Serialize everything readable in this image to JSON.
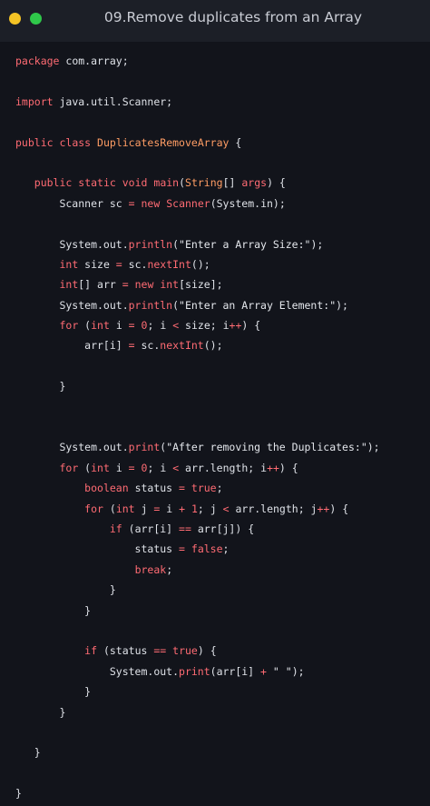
{
  "window": {
    "title": "09.Remove duplicates from an Array",
    "colors": {
      "close": "#f4c325",
      "maximize": "#2fc84a",
      "background": "#12141b",
      "titlebar": "#1c1f27",
      "keyword": "#ff6b73",
      "class_name": "#ff9d64",
      "text": "#dfe2e8"
    }
  },
  "code": {
    "language": "java",
    "lines": [
      [
        {
          "t": "kw",
          "v": "package"
        },
        {
          "t": "plain",
          "v": " com.array;"
        }
      ],
      [],
      [
        {
          "t": "kw",
          "v": "import"
        },
        {
          "t": "plain",
          "v": " java.util.Scanner;"
        }
      ],
      [],
      [
        {
          "t": "kw",
          "v": "public"
        },
        {
          "t": "plain",
          "v": " "
        },
        {
          "t": "kw",
          "v": "class"
        },
        {
          "t": "plain",
          "v": " "
        },
        {
          "t": "cls",
          "v": "DuplicatesRemoveArray"
        },
        {
          "t": "plain",
          "v": " {"
        }
      ],
      [],
      [
        {
          "t": "plain",
          "v": "   "
        },
        {
          "t": "kw",
          "v": "public"
        },
        {
          "t": "plain",
          "v": " "
        },
        {
          "t": "kw",
          "v": "static"
        },
        {
          "t": "plain",
          "v": " "
        },
        {
          "t": "kw",
          "v": "void"
        },
        {
          "t": "plain",
          "v": " "
        },
        {
          "t": "fn",
          "v": "main"
        },
        {
          "t": "plain",
          "v": "("
        },
        {
          "t": "cls",
          "v": "String"
        },
        {
          "t": "plain",
          "v": "[] "
        },
        {
          "t": "kw",
          "v": "args"
        },
        {
          "t": "plain",
          "v": ") {"
        }
      ],
      [
        {
          "t": "plain",
          "v": "       Scanner sc "
        },
        {
          "t": "op",
          "v": "="
        },
        {
          "t": "plain",
          "v": " "
        },
        {
          "t": "kw",
          "v": "new"
        },
        {
          "t": "plain",
          "v": " "
        },
        {
          "t": "fn",
          "v": "Scanner"
        },
        {
          "t": "plain",
          "v": "(System.in);"
        }
      ],
      [],
      [
        {
          "t": "plain",
          "v": "       System.out."
        },
        {
          "t": "fn",
          "v": "println"
        },
        {
          "t": "plain",
          "v": "("
        },
        {
          "t": "str",
          "v": "\"Enter a Array Size:\""
        },
        {
          "t": "plain",
          "v": ");"
        }
      ],
      [
        {
          "t": "plain",
          "v": "       "
        },
        {
          "t": "kw",
          "v": "int"
        },
        {
          "t": "plain",
          "v": " size "
        },
        {
          "t": "op",
          "v": "="
        },
        {
          "t": "plain",
          "v": " sc."
        },
        {
          "t": "fn",
          "v": "nextInt"
        },
        {
          "t": "plain",
          "v": "();"
        }
      ],
      [
        {
          "t": "plain",
          "v": "       "
        },
        {
          "t": "kw",
          "v": "int"
        },
        {
          "t": "plain",
          "v": "[] arr "
        },
        {
          "t": "op",
          "v": "="
        },
        {
          "t": "plain",
          "v": " "
        },
        {
          "t": "kw",
          "v": "new"
        },
        {
          "t": "plain",
          "v": " "
        },
        {
          "t": "kw",
          "v": "int"
        },
        {
          "t": "plain",
          "v": "[size];"
        }
      ],
      [
        {
          "t": "plain",
          "v": "       System.out."
        },
        {
          "t": "fn",
          "v": "println"
        },
        {
          "t": "plain",
          "v": "("
        },
        {
          "t": "str",
          "v": "\"Enter an Array Element:\""
        },
        {
          "t": "plain",
          "v": ");"
        }
      ],
      [
        {
          "t": "plain",
          "v": "       "
        },
        {
          "t": "kw",
          "v": "for"
        },
        {
          "t": "plain",
          "v": " ("
        },
        {
          "t": "kw",
          "v": "int"
        },
        {
          "t": "plain",
          "v": " i "
        },
        {
          "t": "op",
          "v": "="
        },
        {
          "t": "plain",
          "v": " "
        },
        {
          "t": "num",
          "v": "0"
        },
        {
          "t": "plain",
          "v": "; i "
        },
        {
          "t": "op",
          "v": "<"
        },
        {
          "t": "plain",
          "v": " size; i"
        },
        {
          "t": "op",
          "v": "++"
        },
        {
          "t": "plain",
          "v": ") {"
        }
      ],
      [
        {
          "t": "plain",
          "v": "           arr[i] "
        },
        {
          "t": "op",
          "v": "="
        },
        {
          "t": "plain",
          "v": " sc."
        },
        {
          "t": "fn",
          "v": "nextInt"
        },
        {
          "t": "plain",
          "v": "();"
        }
      ],
      [],
      [
        {
          "t": "plain",
          "v": "       }"
        }
      ],
      [],
      [],
      [
        {
          "t": "plain",
          "v": "       System.out."
        },
        {
          "t": "fn",
          "v": "print"
        },
        {
          "t": "plain",
          "v": "("
        },
        {
          "t": "str",
          "v": "\"After removing the Duplicates:\""
        },
        {
          "t": "plain",
          "v": ");"
        }
      ],
      [
        {
          "t": "plain",
          "v": "       "
        },
        {
          "t": "kw",
          "v": "for"
        },
        {
          "t": "plain",
          "v": " ("
        },
        {
          "t": "kw",
          "v": "int"
        },
        {
          "t": "plain",
          "v": " i "
        },
        {
          "t": "op",
          "v": "="
        },
        {
          "t": "plain",
          "v": " "
        },
        {
          "t": "num",
          "v": "0"
        },
        {
          "t": "plain",
          "v": "; i "
        },
        {
          "t": "op",
          "v": "<"
        },
        {
          "t": "plain",
          "v": " arr.length; i"
        },
        {
          "t": "op",
          "v": "++"
        },
        {
          "t": "plain",
          "v": ") {"
        }
      ],
      [
        {
          "t": "plain",
          "v": "           "
        },
        {
          "t": "kw",
          "v": "boolean"
        },
        {
          "t": "plain",
          "v": " status "
        },
        {
          "t": "op",
          "v": "="
        },
        {
          "t": "plain",
          "v": " "
        },
        {
          "t": "kw",
          "v": "true"
        },
        {
          "t": "plain",
          "v": ";"
        }
      ],
      [
        {
          "t": "plain",
          "v": "           "
        },
        {
          "t": "kw",
          "v": "for"
        },
        {
          "t": "plain",
          "v": " ("
        },
        {
          "t": "kw",
          "v": "int"
        },
        {
          "t": "plain",
          "v": " j "
        },
        {
          "t": "op",
          "v": "="
        },
        {
          "t": "plain",
          "v": " i "
        },
        {
          "t": "op",
          "v": "+"
        },
        {
          "t": "plain",
          "v": " "
        },
        {
          "t": "num",
          "v": "1"
        },
        {
          "t": "plain",
          "v": "; j "
        },
        {
          "t": "op",
          "v": "<"
        },
        {
          "t": "plain",
          "v": " arr.length; j"
        },
        {
          "t": "op",
          "v": "++"
        },
        {
          "t": "plain",
          "v": ") {"
        }
      ],
      [
        {
          "t": "plain",
          "v": "               "
        },
        {
          "t": "kw",
          "v": "if"
        },
        {
          "t": "plain",
          "v": " (arr[i] "
        },
        {
          "t": "op",
          "v": "=="
        },
        {
          "t": "plain",
          "v": " arr[j]) {"
        }
      ],
      [
        {
          "t": "plain",
          "v": "                   status "
        },
        {
          "t": "op",
          "v": "="
        },
        {
          "t": "plain",
          "v": " "
        },
        {
          "t": "kw",
          "v": "false"
        },
        {
          "t": "plain",
          "v": ";"
        }
      ],
      [
        {
          "t": "plain",
          "v": "                   "
        },
        {
          "t": "kw",
          "v": "break"
        },
        {
          "t": "plain",
          "v": ";"
        }
      ],
      [
        {
          "t": "plain",
          "v": "               }"
        }
      ],
      [
        {
          "t": "plain",
          "v": "           }"
        }
      ],
      [],
      [
        {
          "t": "plain",
          "v": "           "
        },
        {
          "t": "kw",
          "v": "if"
        },
        {
          "t": "plain",
          "v": " (status "
        },
        {
          "t": "op",
          "v": "=="
        },
        {
          "t": "plain",
          "v": " "
        },
        {
          "t": "kw",
          "v": "true"
        },
        {
          "t": "plain",
          "v": ") {"
        }
      ],
      [
        {
          "t": "plain",
          "v": "               System.out."
        },
        {
          "t": "fn",
          "v": "print"
        },
        {
          "t": "plain",
          "v": "(arr[i] "
        },
        {
          "t": "op",
          "v": "+"
        },
        {
          "t": "plain",
          "v": " "
        },
        {
          "t": "str",
          "v": "\" \""
        },
        {
          "t": "plain",
          "v": ");"
        }
      ],
      [
        {
          "t": "plain",
          "v": "           }"
        }
      ],
      [
        {
          "t": "plain",
          "v": "       }"
        }
      ],
      [],
      [
        {
          "t": "plain",
          "v": "   }"
        }
      ],
      [],
      [
        {
          "t": "plain",
          "v": "}"
        }
      ]
    ]
  }
}
